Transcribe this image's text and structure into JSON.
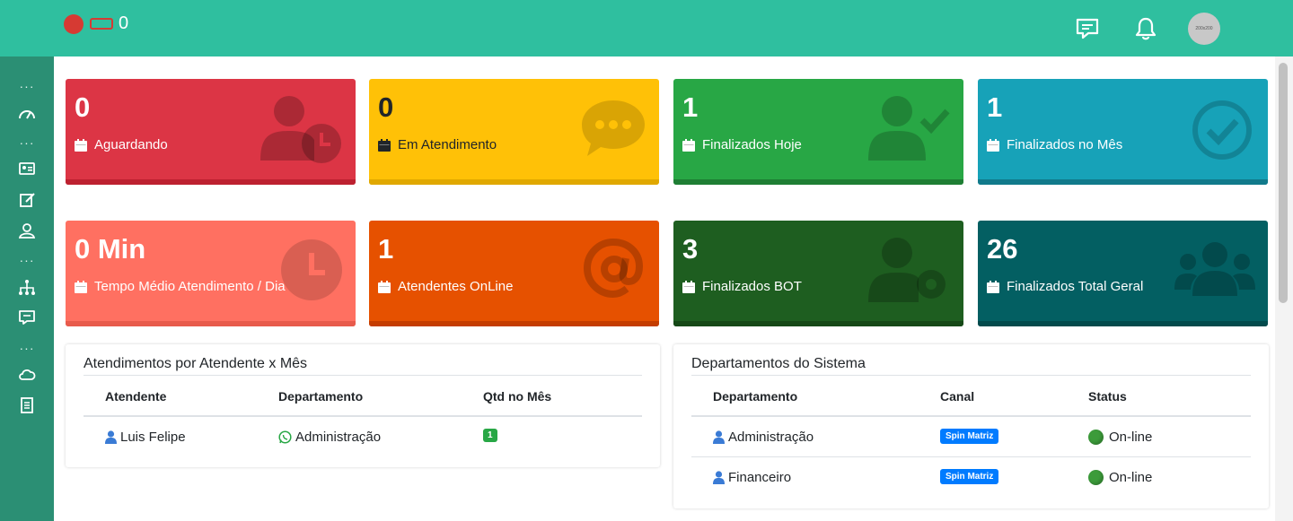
{
  "topbar": {
    "badge_count": "0",
    "avatar_text": "200x200",
    "icons": [
      "chat-icon",
      "bell-icon"
    ]
  },
  "sidebar": {
    "items": [
      "dots",
      "speedometer-icon",
      "dots",
      "contact-card-icon",
      "edit-icon",
      "user-icon",
      "dots",
      "hierarchy-icon",
      "chat-icon",
      "dots",
      "cloud-icon",
      "report-icon"
    ]
  },
  "cards": [
    {
      "value": "0",
      "label": "Aguardando",
      "color": "#dc3545",
      "icon": "user-clock-icon"
    },
    {
      "value": "0",
      "label": "Em Atendimento",
      "color": "#ffc107",
      "icon": "comment-dots-icon"
    },
    {
      "value": "1",
      "label": "Finalizados Hoje",
      "color": "#28a745",
      "icon": "user-check-icon"
    },
    {
      "value": "1",
      "label": "Finalizados no Mês",
      "color": "#17a2b8",
      "icon": "check-circle-icon"
    },
    {
      "value": "0 Min",
      "label": "Tempo Médio Atendimento / Dia",
      "color": "#ff7061",
      "icon": "clock-icon"
    },
    {
      "value": "1",
      "label": "Atendentes OnLine",
      "color": "#e65100",
      "icon": "at-icon"
    },
    {
      "value": "3",
      "label": "Finalizados BOT",
      "color": "#1e5e20",
      "icon": "user-cog-icon"
    },
    {
      "value": "26",
      "label": "Finalizados Total Geral",
      "color": "#035f62",
      "icon": "users-icon"
    }
  ],
  "panel_atendentes": {
    "title": "Atendimentos por Atendente x Mês",
    "headers": [
      "Atendente",
      "Departamento",
      "Qtd no Mês"
    ],
    "rows": [
      {
        "atendente": "Luis Felipe",
        "departamento": "Administração",
        "qtd": "1"
      }
    ]
  },
  "panel_departamentos": {
    "title": "Departamentos do Sistema",
    "headers": [
      "Departamento",
      "Canal",
      "Status"
    ],
    "rows": [
      {
        "departamento": "Administração",
        "canal": "Spin Matriz",
        "status": "On-line"
      },
      {
        "departamento": "Financeiro",
        "canal": "Spin Matriz",
        "status": "On-line"
      }
    ]
  }
}
